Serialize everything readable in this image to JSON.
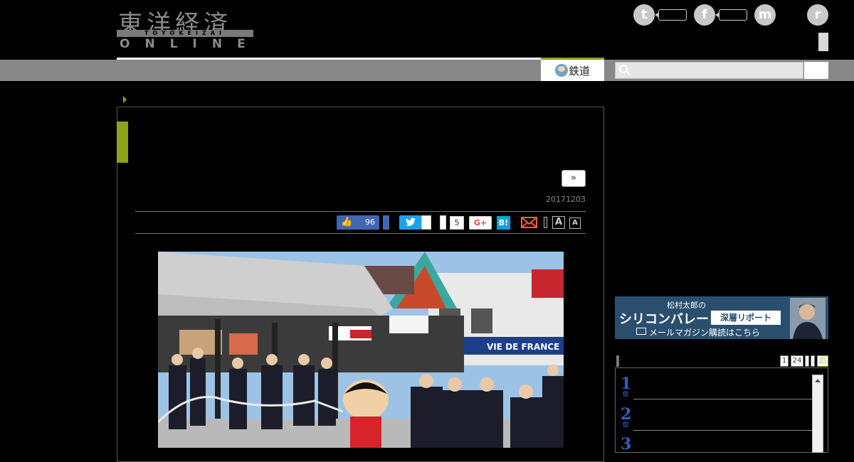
{
  "header": {
    "logo_kanji": "東洋経済",
    "logo_romaji": "TOYOKEIZAI",
    "logo_online": "ONLINE",
    "social": [
      {
        "icon": "twitter-icon",
        "glyph": "t"
      },
      {
        "icon": "facebook-icon",
        "glyph": "f"
      },
      {
        "icon": "messenger-icon",
        "glyph": "m"
      },
      {
        "icon": "rss-icon",
        "glyph": "r"
      }
    ]
  },
  "nav": {
    "active_tab": "鉄道"
  },
  "article": {
    "next_label": "»",
    "date": "20171203",
    "share": {
      "fb_like_count": "96",
      "twitter_glyph": "t",
      "pocket_count": "5",
      "gplus_label": "G+",
      "hatena_label": "B!",
      "font_large": "A",
      "font_small": "A"
    }
  },
  "sidebar": {
    "banner": {
      "line1": "松村太郎の",
      "line2": "シリコンバレー",
      "line3": "深層リポート",
      "line4": "メールマガジン購読はこちら"
    },
    "ranking": {
      "tabs": [
        "1",
        "24",
        "",
        ""
      ],
      "items": [
        {
          "num": "1",
          "unit": "位"
        },
        {
          "num": "2",
          "unit": "位"
        },
        {
          "num": "3",
          "unit": ""
        }
      ]
    }
  },
  "colors": {
    "accent": "#8fa31a",
    "nav_bg": "#888888",
    "page_bg": "#000000",
    "facebook": "#4267b2",
    "twitter": "#1da1f2",
    "hatena": "#00a4de",
    "rank_blue": "#3060c0"
  }
}
